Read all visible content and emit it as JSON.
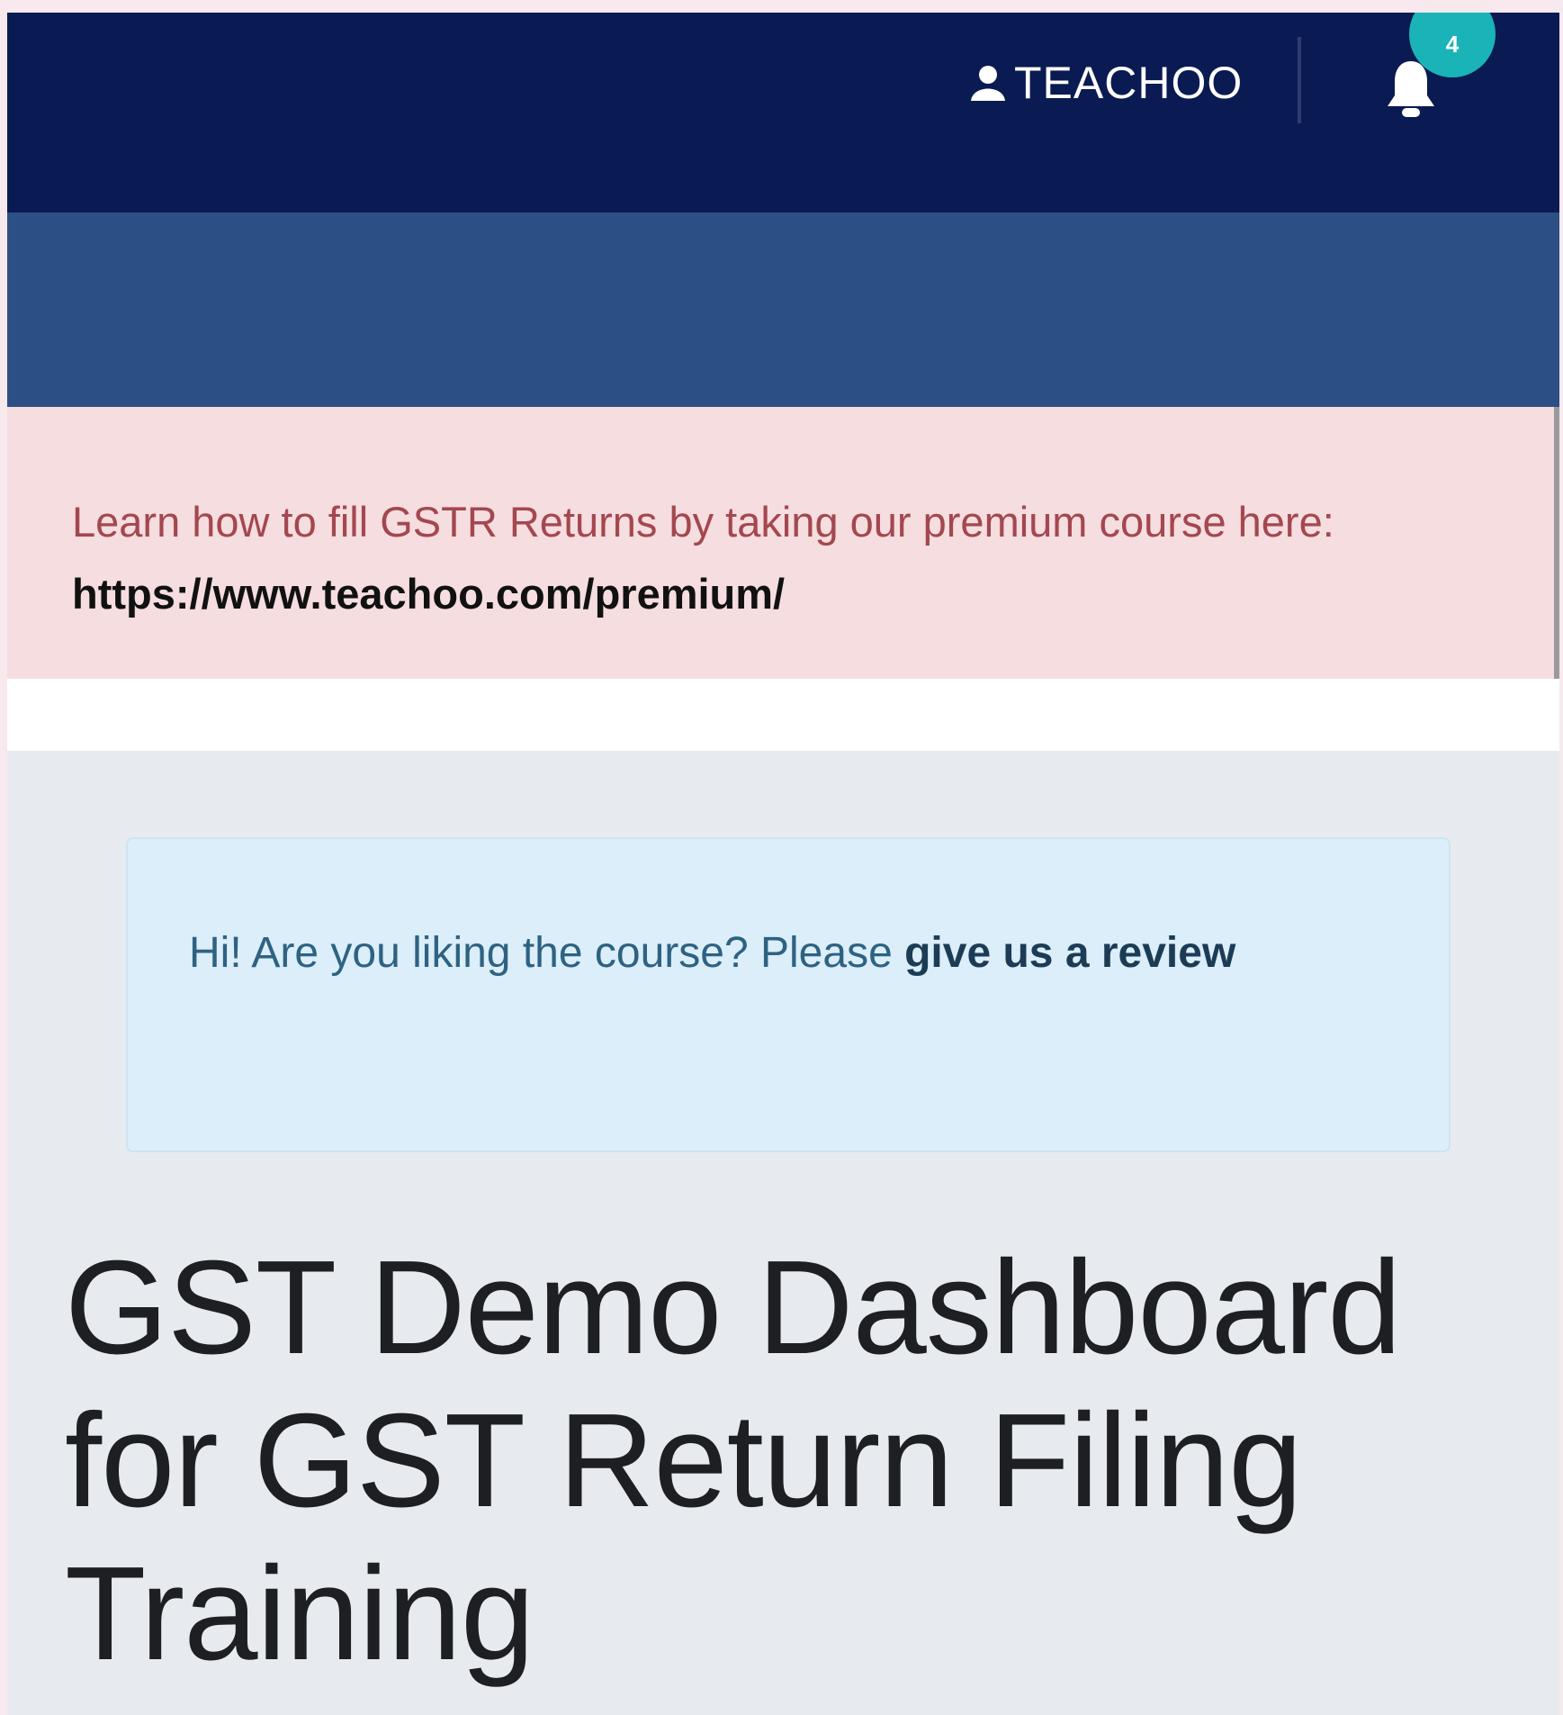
{
  "header": {
    "user_name": "TEACHOO",
    "notification_count": "4"
  },
  "promo_alert": {
    "text": "Learn how to fill GSTR Returns by taking our premium course here: ",
    "link_text": "https://www.teachoo.com/premium/"
  },
  "review_prompt": {
    "text": "Hi! Are you liking the course? Please ",
    "link_text": "give us a review"
  },
  "page": {
    "title": "GST Demo Dashboard for GST Return Filing Training"
  },
  "colors": {
    "topbar": "#0a1a52",
    "subbar": "#2c4f85",
    "badge": "#1ab3b8",
    "alert_background": "#f5dde0",
    "info_background": "#dbeef9",
    "page_background": "#e7ebf0"
  }
}
